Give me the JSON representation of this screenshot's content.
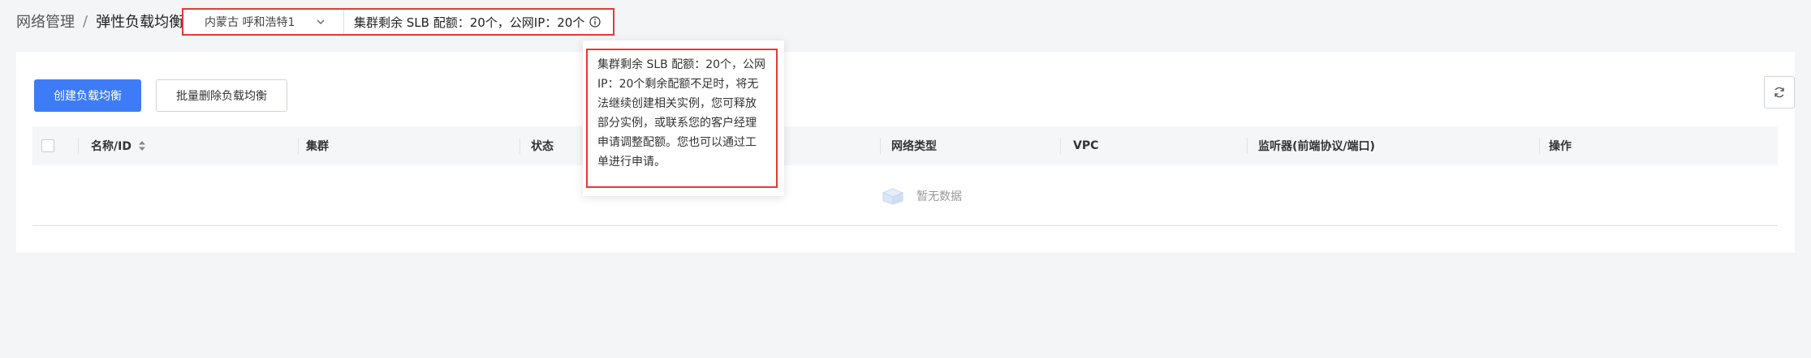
{
  "breadcrumb": {
    "parent": "网络管理",
    "separator": "/",
    "current": "弹性负载均衡"
  },
  "region_select": {
    "value": "内蒙古  呼和浩特1"
  },
  "quota": {
    "text": "集群剩余 SLB 配额：20个，公网IP：20个"
  },
  "toolbar": {
    "create_label": "创建负载均衡",
    "batch_delete_label": "批量删除负载均衡"
  },
  "table": {
    "columns": [
      "名称/ID",
      "集群",
      "状态",
      "网络类型",
      "VPC",
      "监听器(前端协议/端口)",
      "操作"
    ],
    "empty_text": "暂无数据"
  },
  "tooltip": {
    "text": "集群剩余 SLB 配额：20个，公网IP：20个剩余配额不足时，将无法继续创建相关实例，您可释放部分实例，或联系您的客户经理申请调整配额。您也可以通过工单进行申请。"
  },
  "colors": {
    "primary": "#3d7cf6",
    "highlight_border": "#e53935"
  }
}
